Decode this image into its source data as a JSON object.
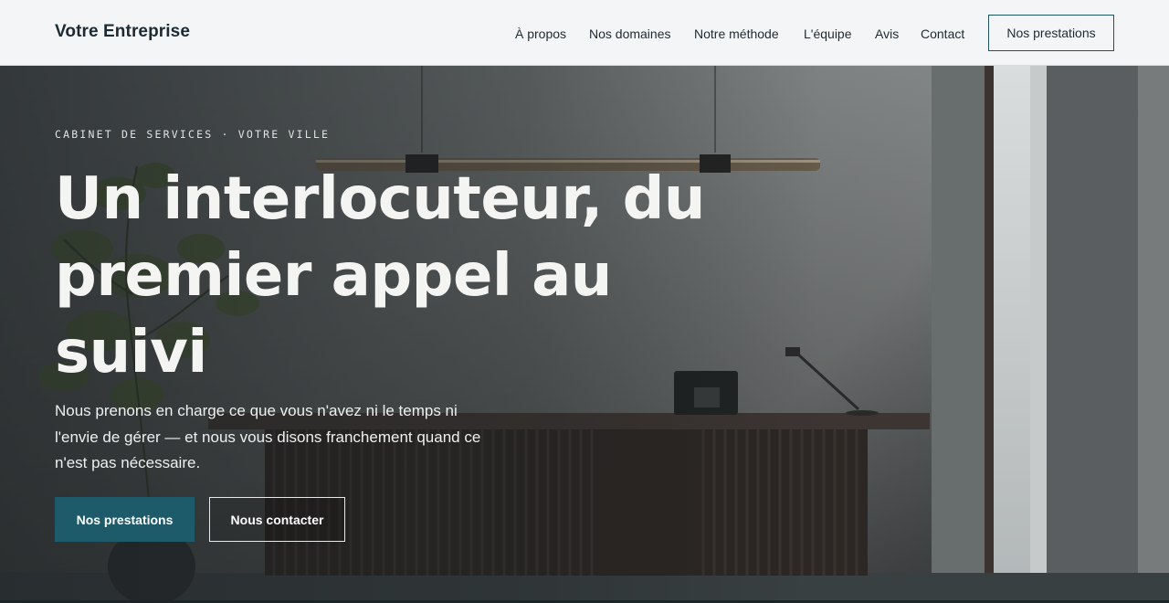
{
  "header": {
    "brand": "Votre Entreprise",
    "nav": [
      {
        "label": "À propos"
      },
      {
        "label": "Nos domaines"
      },
      {
        "label": "Notre méthode"
      },
      {
        "label": "L'équipe"
      },
      {
        "label": "Avis"
      },
      {
        "label": "Contact"
      }
    ],
    "cta": "Nos prestations"
  },
  "hero": {
    "eyebrow": "CABINET DE SERVICES · VOTRE VILLE",
    "headline": "Un interlocuteur, du premier appel au suivi",
    "lead": "Nous prenons en charge ce que vous n'avez ni le temps ni l'envie de gérer — et nous vous disons franchement quand ce n'est pas nécessaire.",
    "primary_button": "Nos prestations",
    "secondary_button": "Nous contacter"
  },
  "colors": {
    "accent": "#1e5b6a",
    "header_bg": "#f3f5f7",
    "text_dark": "#1b2a33"
  }
}
